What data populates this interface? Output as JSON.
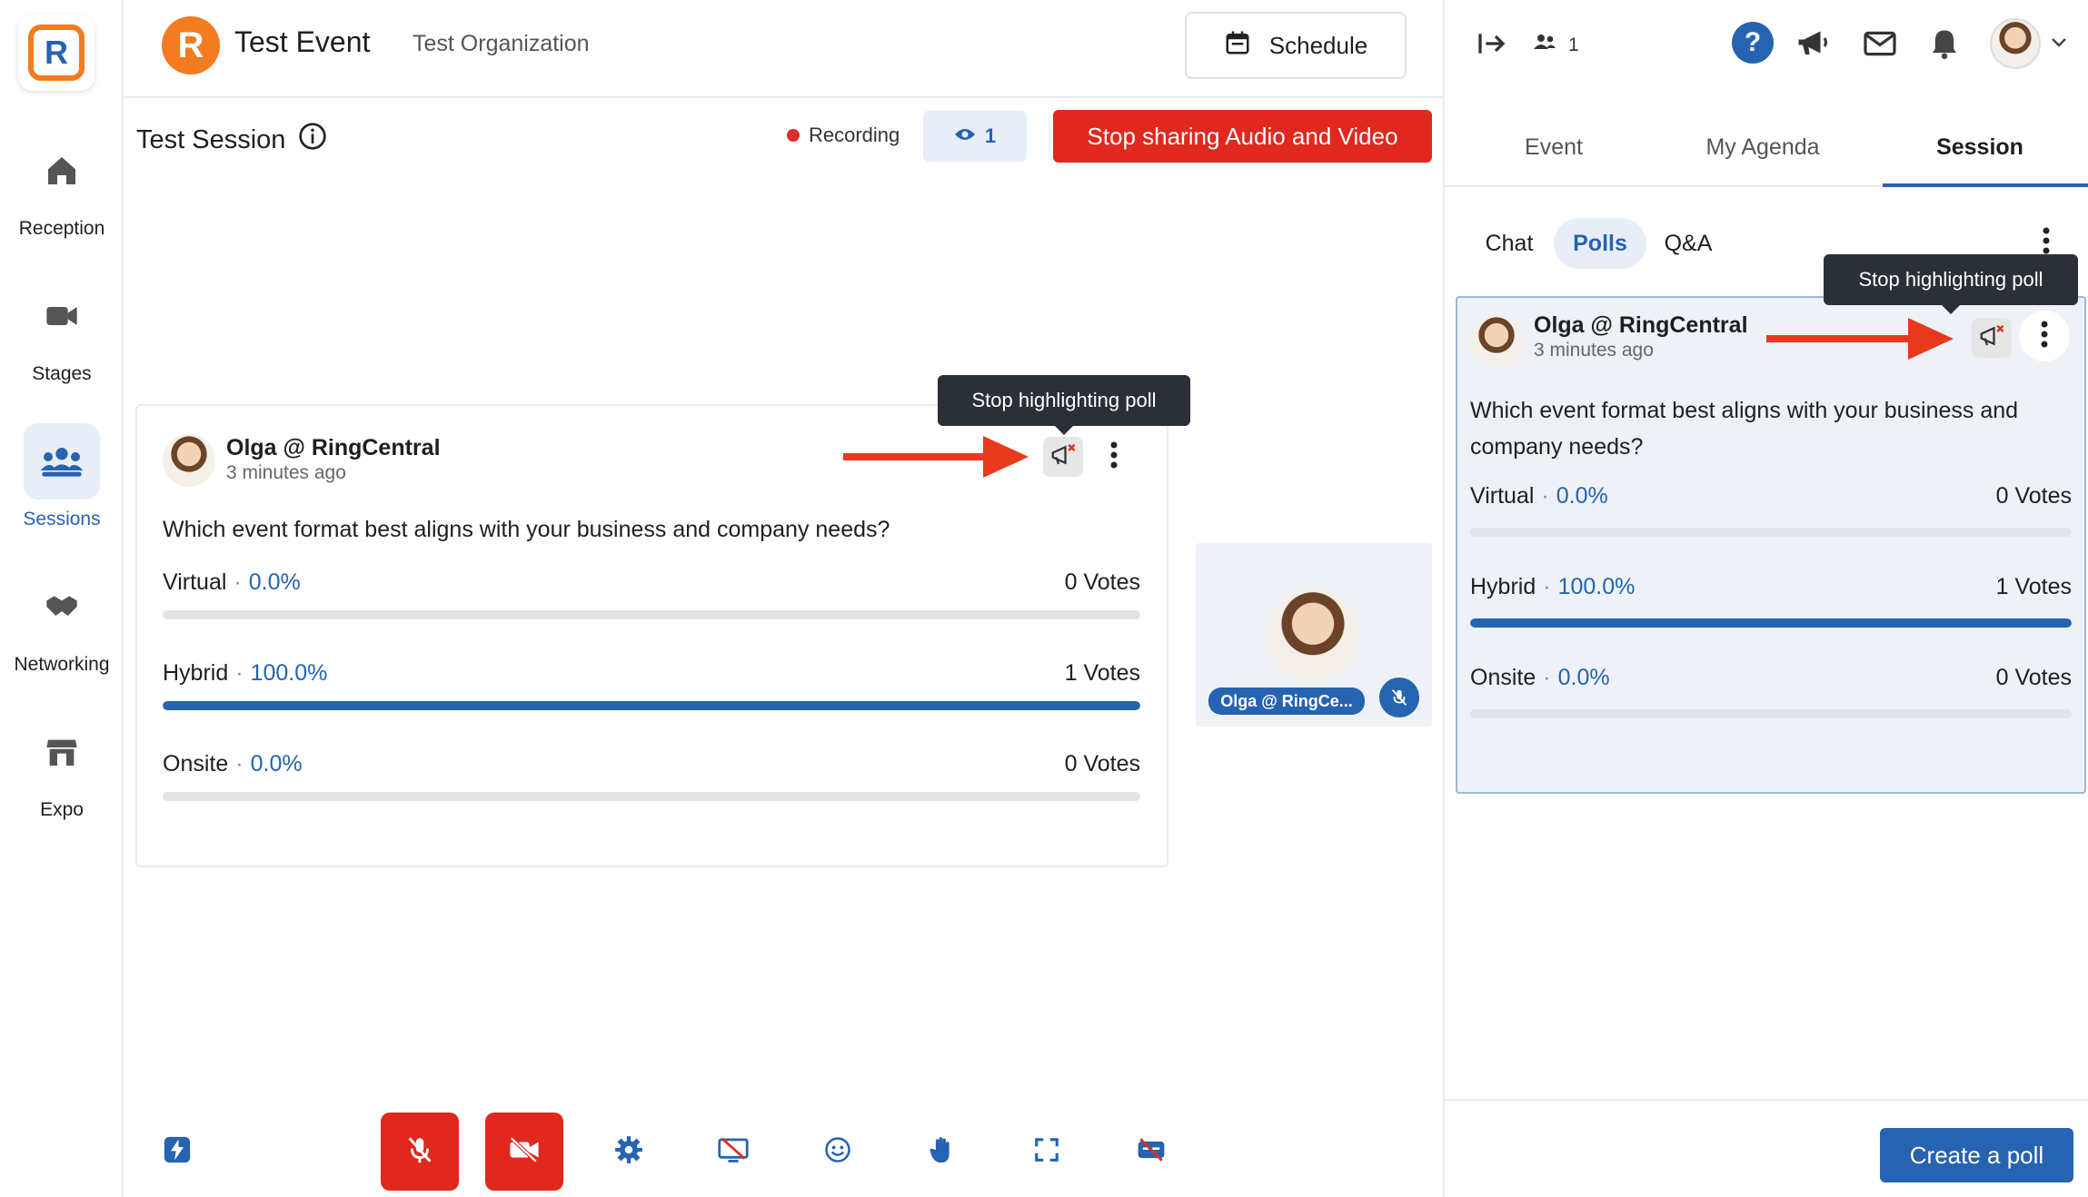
{
  "app": {
    "logo_letter": "R"
  },
  "nav": {
    "items": [
      {
        "label": "Reception"
      },
      {
        "label": "Stages"
      },
      {
        "label": "Sessions"
      },
      {
        "label": "Networking"
      },
      {
        "label": "Expo"
      }
    ]
  },
  "header": {
    "event_logo_letter": "R",
    "event_title": "Test Event",
    "org_title": "Test Organization",
    "schedule_label": "Schedule"
  },
  "session": {
    "title": "Test Session",
    "recording_label": "Recording",
    "viewer_count": "1",
    "stop_sharing_label": "Stop sharing Audio and Video"
  },
  "poll": {
    "author": "Olga @ RingCentral",
    "time": "3 minutes ago",
    "question": "Which event format best aligns with your business and company needs?",
    "tooltip": "Stop highlighting poll",
    "options": [
      {
        "label": "Virtual",
        "pct": "0.0%",
        "votes": "0 Votes",
        "fill": 0
      },
      {
        "label": "Hybrid",
        "pct": "100.0%",
        "votes": "1 Votes",
        "fill": 1
      },
      {
        "label": "Onsite",
        "pct": "0.0%",
        "votes": "0 Votes",
        "fill": 0
      }
    ]
  },
  "participant": {
    "name": "Olga @ RingCe..."
  },
  "right_panel": {
    "participants_count": "1",
    "help_label": "?",
    "tabs": [
      "Event",
      "My Agenda",
      "Session"
    ],
    "subtabs": [
      "Chat",
      "Polls",
      "Q&A"
    ],
    "create_poll_label": "Create a poll"
  },
  "colors": {
    "accent": "#2663b0",
    "danger": "#e0281f",
    "brand_orange": "#f47b20",
    "arrow": "#e8391f"
  }
}
